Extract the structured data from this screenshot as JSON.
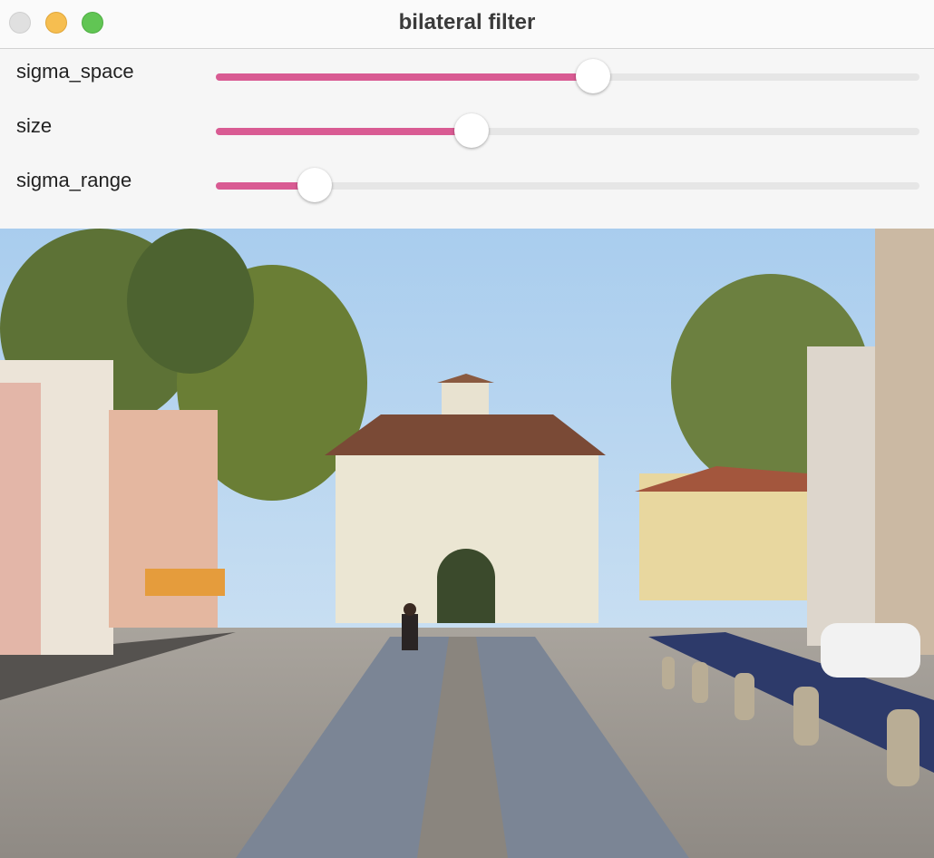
{
  "window": {
    "title": "bilateral filter"
  },
  "sliders": [
    {
      "label": "sigma_space",
      "value_fraction": 0.536
    },
    {
      "label": "size",
      "value_fraction": 0.363
    },
    {
      "label": "sigma_range",
      "value_fraction": 0.14
    }
  ],
  "colors": {
    "accent": "#d95b93",
    "track": "#e6e6e6"
  }
}
